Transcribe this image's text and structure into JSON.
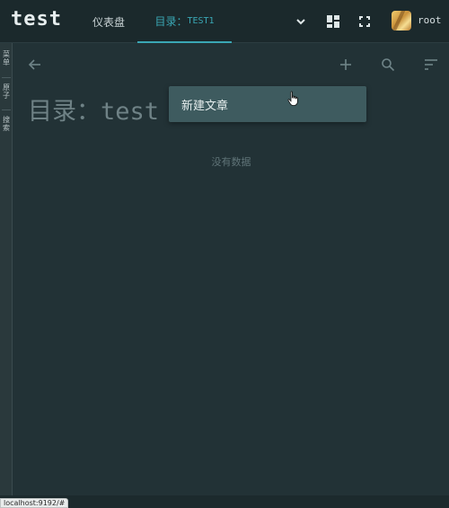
{
  "header": {
    "app_title": "test",
    "tabs": [
      {
        "label": "仪表盘",
        "active": false
      },
      {
        "label_prefix": "目录：",
        "label_suffix": "TEST1",
        "active": true
      }
    ],
    "user": {
      "name": "root"
    }
  },
  "sidebar": {
    "items": [
      {
        "label": "菜单"
      },
      {
        "label": "原子"
      },
      {
        "label": "搜索"
      }
    ]
  },
  "main": {
    "title_prefix": "目录：",
    "title_suffix": "test",
    "empty_text": "没有数据"
  },
  "add_menu": {
    "items": [
      {
        "label": "新建文章"
      }
    ]
  },
  "status": {
    "url": "localhost:9192/#"
  },
  "colors": {
    "background": "#223236",
    "header": "#1b292c",
    "accent": "#3aa7b5",
    "menu": "#3e5b5f"
  },
  "icons": [
    "chevron-down-icon",
    "dashboard-layout-icon",
    "fullscreen-icon",
    "back-arrow-icon",
    "add-icon",
    "search-icon",
    "sort-icon"
  ]
}
